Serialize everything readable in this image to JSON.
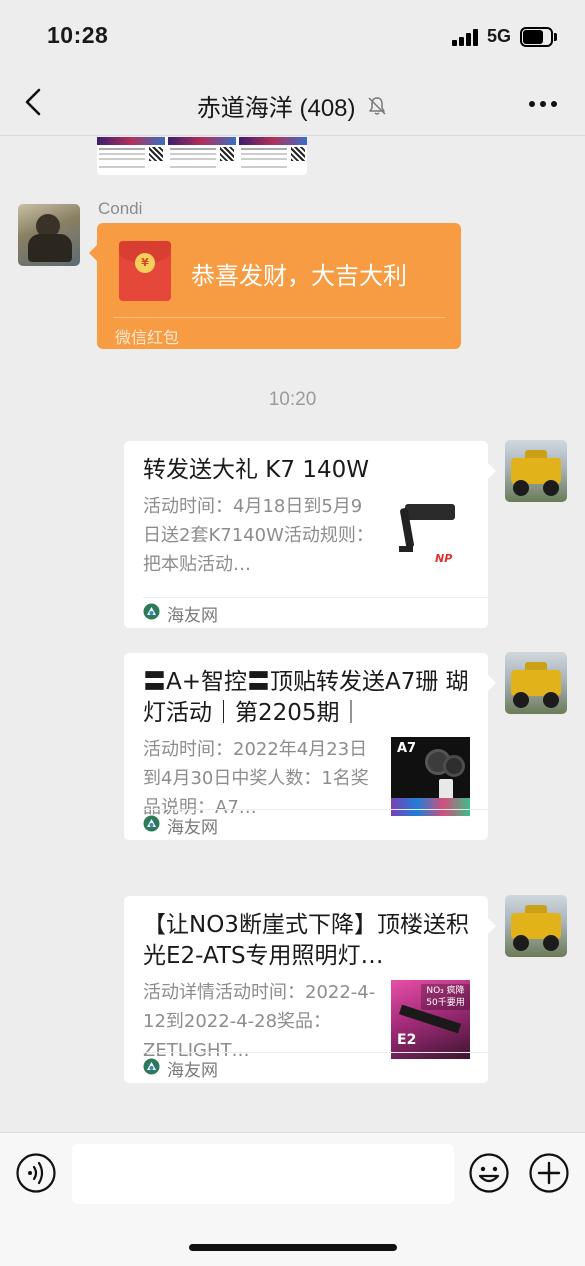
{
  "status_bar": {
    "time": "10:28",
    "network": "5G",
    "battery_level": 0.75
  },
  "nav": {
    "title": "赤道海洋 (408)",
    "icons": [
      "back-icon",
      "mute-icon",
      "more-icon"
    ]
  },
  "messages": {
    "redpacket": {
      "sender": "Condi",
      "greeting": "恭喜发财，大吉大利",
      "label": "微信红包"
    },
    "timestamp": "10:20",
    "cards": [
      {
        "title": "转发送大礼 K7 140W",
        "desc": "活动时间：4月18日到5月9日送2套K7140W活动规则：把本贴活动…",
        "source": "海友网",
        "thumb_label": "NP"
      },
      {
        "title": "〓A+智控〓顶贴转发送A7珊 瑚灯活动｜第2205期｜",
        "desc": "活动时间：2022年4月23日到4月30日中奖人数：1名奖品说明：A7…",
        "source": "海友网",
        "thumb_label": "A7"
      },
      {
        "title": "【让NO3断崖式下降】顶楼送积光E2-ATS专用照明灯…",
        "desc": "活动详情活动时间：2022-4-12到2022-4-28奖品：ZETLIGHT…",
        "source": "海友网",
        "thumb_label": "E2",
        "thumb_badge": "NO₃ 疯降 50千要用"
      }
    ]
  },
  "input_bar": {
    "placeholder": "",
    "icons": [
      "voice-icon",
      "emoji-icon",
      "plus-icon"
    ]
  },
  "colors": {
    "background": "#ededed",
    "redpacket": "#f79c43",
    "card": "#ffffff",
    "timestamp": "#9b9b9b",
    "source_icon": "#2c7a5a"
  }
}
